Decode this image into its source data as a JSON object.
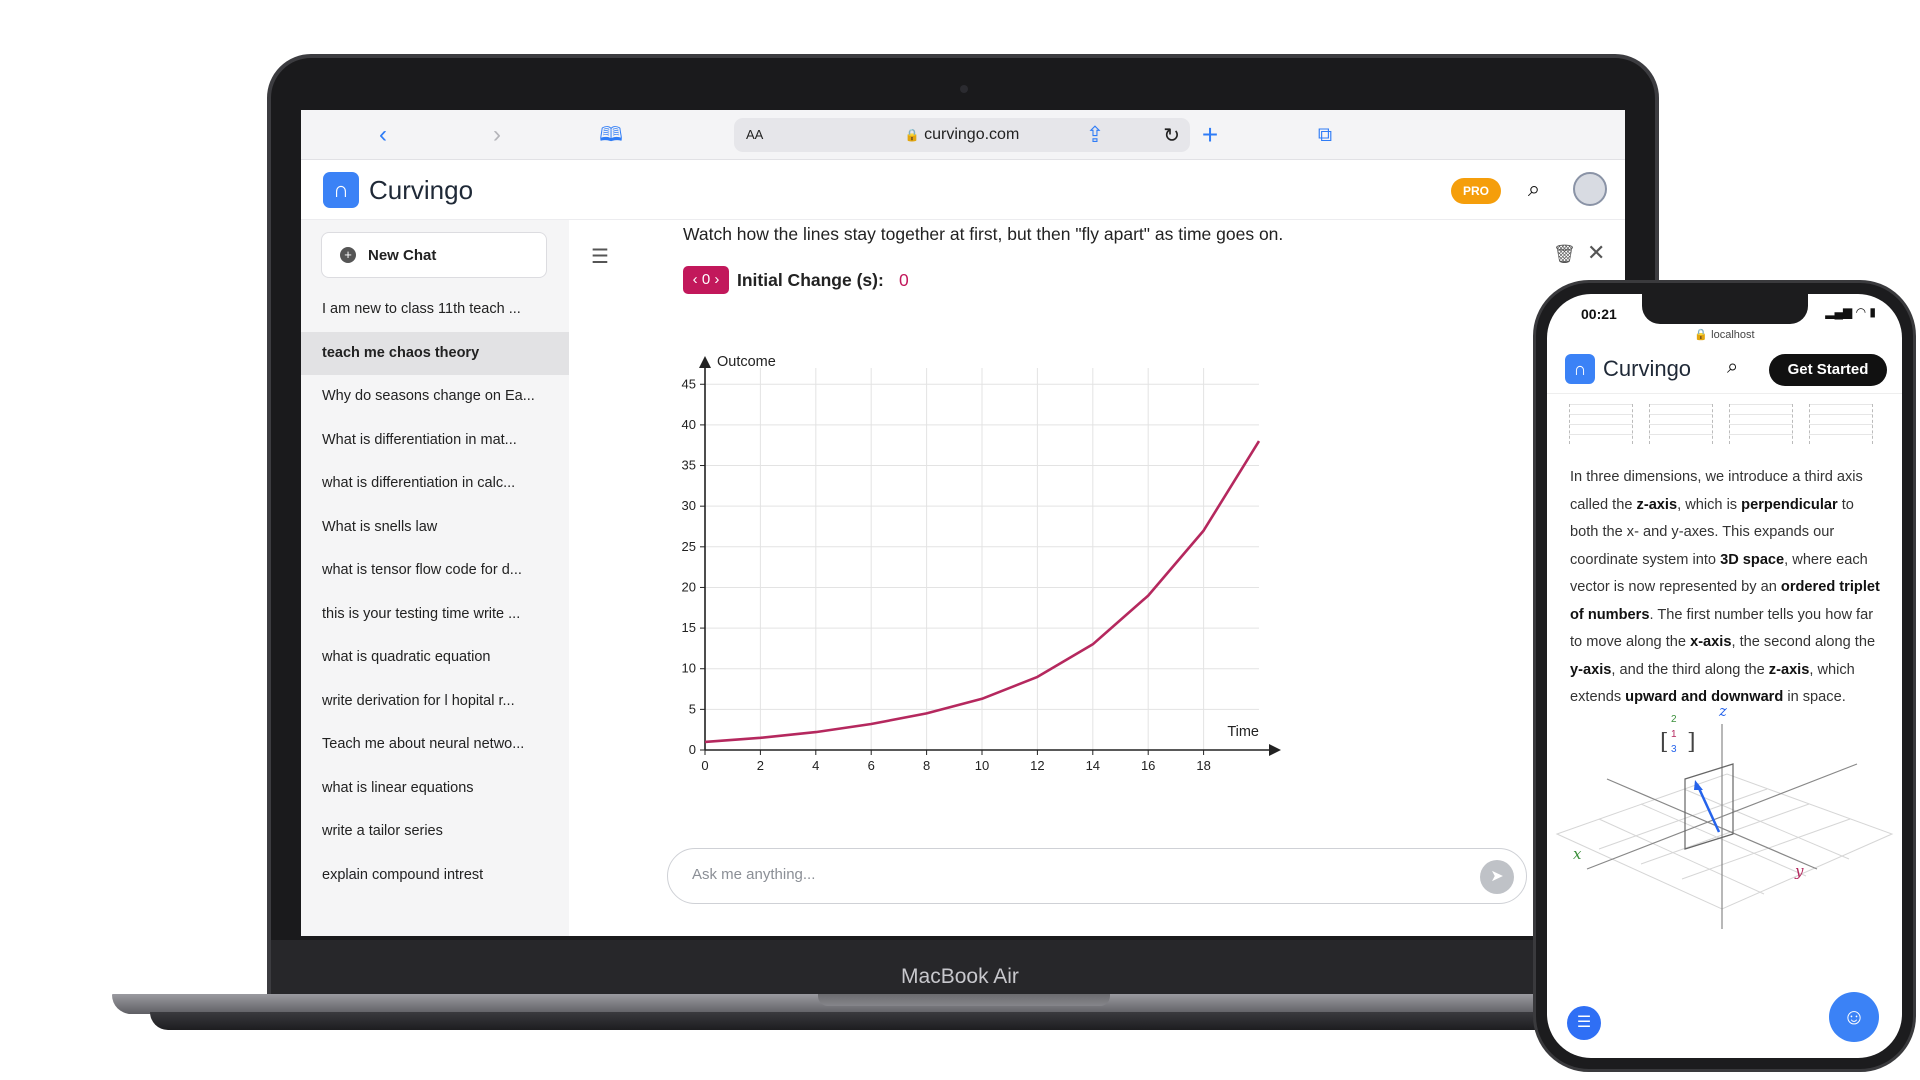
{
  "browser": {
    "address_aa": "AA",
    "url": "curvingo.com"
  },
  "app": {
    "name": "Curvingo",
    "pro_badge": "PRO"
  },
  "sidebar": {
    "new_chat_label": "New Chat",
    "items": [
      {
        "label": "I am new to class 11th teach ..."
      },
      {
        "label": "teach me chaos theory",
        "active": true
      },
      {
        "label": "Why do seasons change on Ea..."
      },
      {
        "label": "What is differentiation in mat..."
      },
      {
        "label": "what is differentiation in calc..."
      },
      {
        "label": "What is snells law"
      },
      {
        "label": "what is tensor flow code for d..."
      },
      {
        "label": "this is your testing time write ..."
      },
      {
        "label": "what is quadratic equation"
      },
      {
        "label": "write derivation for l hopital r..."
      },
      {
        "label": "Teach me about neural netwo..."
      },
      {
        "label": "what is linear equations"
      },
      {
        "label": "write a tailor series"
      },
      {
        "label": "explain compound intrest"
      }
    ]
  },
  "main": {
    "intro": "Watch how the lines stay together at first, but then \"fly apart\" as time goes on.",
    "stepper_value": "0",
    "param_label": "Initial Change (s):",
    "param_value": "0",
    "ask_placeholder": "Ask me anything..."
  },
  "chart_data": {
    "type": "line",
    "xlabel": "Time",
    "ylabel": "Outcome",
    "xlim": [
      0,
      20
    ],
    "ylim": [
      0,
      47
    ],
    "x_ticks": [
      0,
      2,
      4,
      6,
      8,
      10,
      12,
      14,
      16,
      18
    ],
    "y_ticks": [
      0,
      5,
      10,
      15,
      20,
      25,
      30,
      35,
      40,
      45
    ],
    "grid": true,
    "series": [
      {
        "color": "#b5285e",
        "x": [
          0,
          2,
          4,
          6,
          8,
          10,
          12,
          14,
          16,
          18,
          20
        ],
        "y": [
          1.0,
          1.5,
          2.2,
          3.2,
          4.5,
          6.3,
          9.0,
          13.0,
          19.0,
          27.0,
          38.0
        ]
      }
    ]
  },
  "device_label": "MacBook Air",
  "phone": {
    "time": "00:21",
    "url": "localhost",
    "app_name": "Curvingo",
    "cta": "Get Started",
    "paragraph": [
      {
        "t": "In three dimensions, we introduce a third axis called the "
      },
      {
        "t": "z-axis",
        "b": true
      },
      {
        "t": ", which is "
      },
      {
        "t": "perpendicular",
        "b": true
      },
      {
        "t": " to both the x- and y-axes. This expands our coordinate system into "
      },
      {
        "t": "3D space",
        "b": true
      },
      {
        "t": ", where each vector is now represented by an "
      },
      {
        "t": "ordered triplet of numbers",
        "b": true
      },
      {
        "t": ". The first number tells you how far to move along the "
      },
      {
        "t": "x-axis",
        "b": true
      },
      {
        "t": ", the second along the "
      },
      {
        "t": "y-axis",
        "b": true
      },
      {
        "t": ", and the third along the "
      },
      {
        "t": "z-axis",
        "b": true
      },
      {
        "t": ", which extends "
      },
      {
        "t": "upward and downward",
        "b": true
      },
      {
        "t": " in space."
      }
    ],
    "vector": [
      "2",
      "1",
      "3"
    ],
    "axis_labels": {
      "x": "x",
      "y": "y",
      "z": "z"
    }
  }
}
